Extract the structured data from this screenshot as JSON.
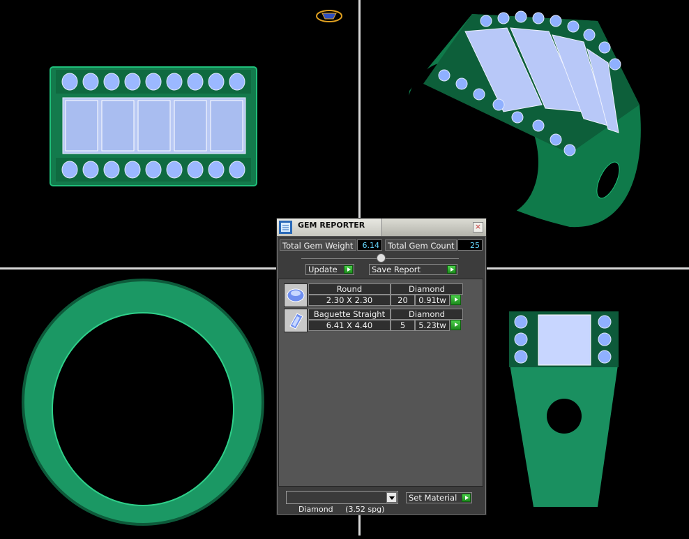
{
  "panel": {
    "title": "GEM REPORTER",
    "close_symbol": "×",
    "total_gem_weight_label": "Total Gem Weight",
    "total_gem_weight_value": "6.14",
    "total_gem_count_label": "Total Gem Count",
    "total_gem_count_value": "25",
    "update_label": "Update",
    "save_report_label": "Save Report",
    "gems": [
      {
        "icon": "round-gem-icon",
        "shape": "Round",
        "material": "Diamond",
        "size": "2.30 X 2.30",
        "count": "20",
        "weight": "0.91tw"
      },
      {
        "icon": "baguette-gem-icon",
        "shape": "Baguette Straight",
        "material": "Diamond",
        "size": "6.41 X 4.40",
        "count": "5",
        "weight": "5.23tw"
      }
    ],
    "material_select_value": "Diamond     (3.52 spg)",
    "set_material_label": "Set Material"
  },
  "colors": {
    "metal": "#1f9e6a",
    "metal_dark": "#0d5a3a",
    "gem": "#a8c4ff",
    "background": "#000000",
    "accent_arrow": "#2fb52f"
  }
}
